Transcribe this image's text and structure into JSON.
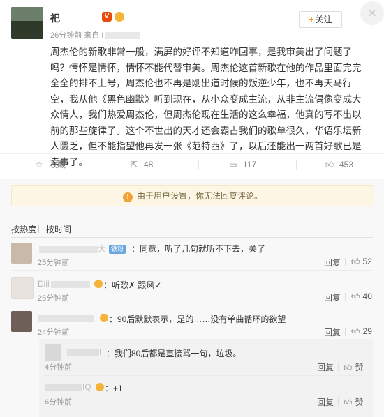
{
  "post": {
    "author": "祀",
    "verified_icon": "verified-v-icon",
    "meta_time": "26分钟前",
    "meta_source": "来自 I",
    "follow_label": "关注",
    "close_glyph": "×",
    "body": "周杰伦的新歌非常一般，满屏的好评不知道咋回事，是我审美出了问题了吗？情怀是情怀，情怀不能代替审美。周杰伦这首新歌在他的作品里面完完全全的排不上号，周杰伦也不再是刚出道时候的叛逆少年，也不再天马行空，我从他《黑色幽默》听到现在，从小众变成主流，从非主流偶像变成大众情人，我们热爱周杰伦，但周杰伦现在生活的这么幸福，他真的写不出以前的那些旋律了。这个不世出的天才还会霸占我们的歌单很久，华语乐坛新人匮乏，但不能指望他再发一张《范特西》了，以后还能出一两首好歌已是幸事了。",
    "actions": {
      "favorite": "收藏",
      "repost_count": "48",
      "comment_count": "117",
      "like_count": "453"
    }
  },
  "comments_section": {
    "notice": "由于用户设置，你无法回复评论。",
    "sort_hot": "按热度",
    "sort_time": "按时间",
    "comments": [
      {
        "name": "",
        "name_tail": "大",
        "tag": "铁粉",
        "text": "：同意，听了几句就听不下去，关了",
        "time": "25分钟前",
        "reply": "回复",
        "likes": "52"
      },
      {
        "name": "Diii",
        "text": "：听歌✗ 跟风✓",
        "time": "25分钟前",
        "reply": "回复",
        "likes": "40"
      },
      {
        "name": "",
        "text": "：90后默默表示，是的……没有单曲循环的欲望",
        "time": "24分钟前",
        "reply": "回复",
        "likes": "29"
      }
    ],
    "sub_comments": [
      {
        "name": "I",
        "text": "：我们80后都是直接骂一句，垃圾。",
        "time": "4分钟前",
        "reply": "回复",
        "like_label": "赞"
      },
      {
        "name": "IQ",
        "text": "：+1",
        "time": "6分钟前",
        "reply": "回复",
        "like_label": "赞"
      }
    ]
  }
}
